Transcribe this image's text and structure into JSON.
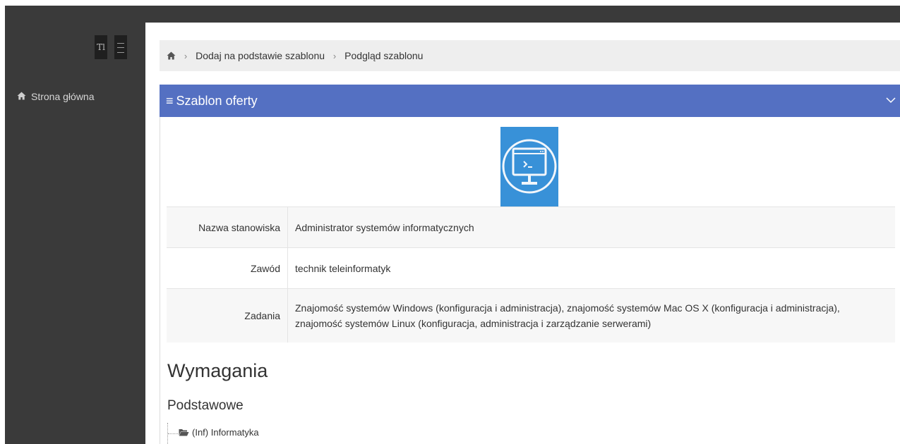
{
  "sidebar": {
    "text_size_glyph": "Tl",
    "items": [
      {
        "label": "Strona główna",
        "icon": "home-icon"
      }
    ]
  },
  "breadcrumb": {
    "home_icon": "home-icon",
    "separator": "›",
    "items": [
      "Dodaj na podstawie szablonu",
      "Podgląd szablonu"
    ]
  },
  "panel": {
    "title": "Szablon oferty",
    "title_icon": "hamburger-icon",
    "toggle_icon": "chevron-down-icon",
    "header_color": "#5470c2"
  },
  "logo": {
    "icon": "terminal-monitor-icon",
    "background": "#3891d8"
  },
  "details": [
    {
      "label": "Nazwa stanowiska",
      "value": "Administrator systemów informatycznych"
    },
    {
      "label": "Zawód",
      "value": "technik teleinformatyk"
    },
    {
      "label": "Zadania",
      "value": "Znajomość systemów Windows (konfiguracja i administracja), znajomość systemów Mac OS X (konfiguracja i administracja), znajomość systemów Linux (konfiguracja, administracja i zarządzanie serwerami)"
    }
  ],
  "requirements": {
    "title": "Wymagania",
    "subtitle": "Podstawowe",
    "tree": [
      {
        "label": "(Inf) Informatyka",
        "icon": "folder-open-icon"
      }
    ]
  }
}
